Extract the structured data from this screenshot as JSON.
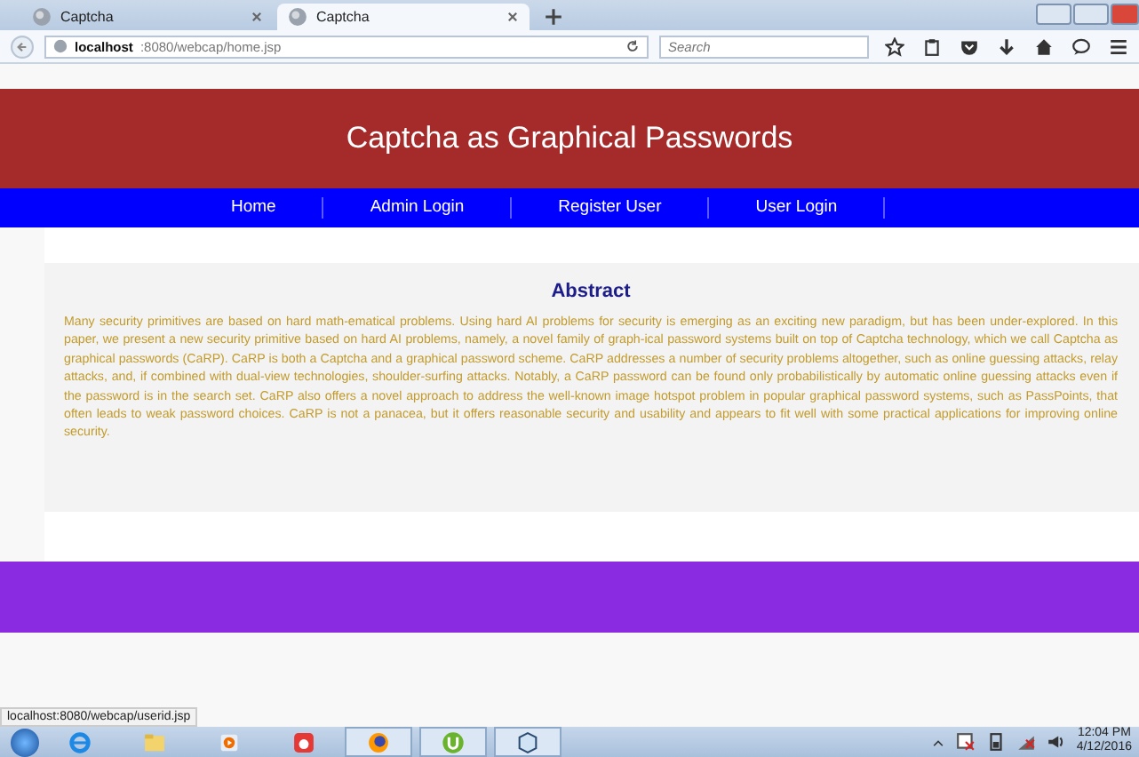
{
  "browser": {
    "tabs": [
      {
        "title": "Captcha",
        "selected": false
      },
      {
        "title": "Captcha",
        "selected": true
      }
    ],
    "url_host": "localhost",
    "url_path": ":8080/webcap/home.jsp",
    "search_placeholder": "Search"
  },
  "header": {
    "title": "Captcha as Graphical Passwords"
  },
  "nav": [
    {
      "label": "Home"
    },
    {
      "label": "Admin Login"
    },
    {
      "label": "Register User"
    },
    {
      "label": "User Login"
    }
  ],
  "article": {
    "heading": "Abstract",
    "body": "Many security primitives are based on hard math-ematical problems. Using hard AI problems for security is emerging as an exciting new paradigm, but has been under-explored. In this paper, we present a new security primitive based on hard AI problems, namely, a novel family of graph-ical password systems built on top of Captcha technology, which we call Captcha as graphical passwords (CaRP). CaRP is both a Captcha and a graphical password scheme. CaRP addresses a number of security problems altogether, such as online guessing attacks, relay attacks, and, if combined with dual-view technologies, shoulder-surfing attacks. Notably, a CaRP password can be found only probabilistically by automatic online guessing attacks even if the password is in the search set. CaRP also offers a novel approach to address the well-known image hotspot problem in popular graphical password systems, such as PassPoints, that often leads to weak password choices. CaRP is not a panacea, but it offers reasonable security and usability and appears to fit well with some practical applications for improving online security."
  },
  "status_url": "localhost:8080/webcap/userid.jsp",
  "taskbar": {
    "apps": [
      {
        "kind": "ie",
        "selected": false
      },
      {
        "kind": "folder",
        "selected": false
      },
      {
        "kind": "media",
        "selected": false
      },
      {
        "kind": "recorder",
        "selected": false
      },
      {
        "kind": "firefox",
        "selected": true
      },
      {
        "kind": "torrent",
        "selected": true
      },
      {
        "kind": "box",
        "selected": true
      }
    ],
    "time": "12:04 PM",
    "date": "4/12/2016"
  }
}
